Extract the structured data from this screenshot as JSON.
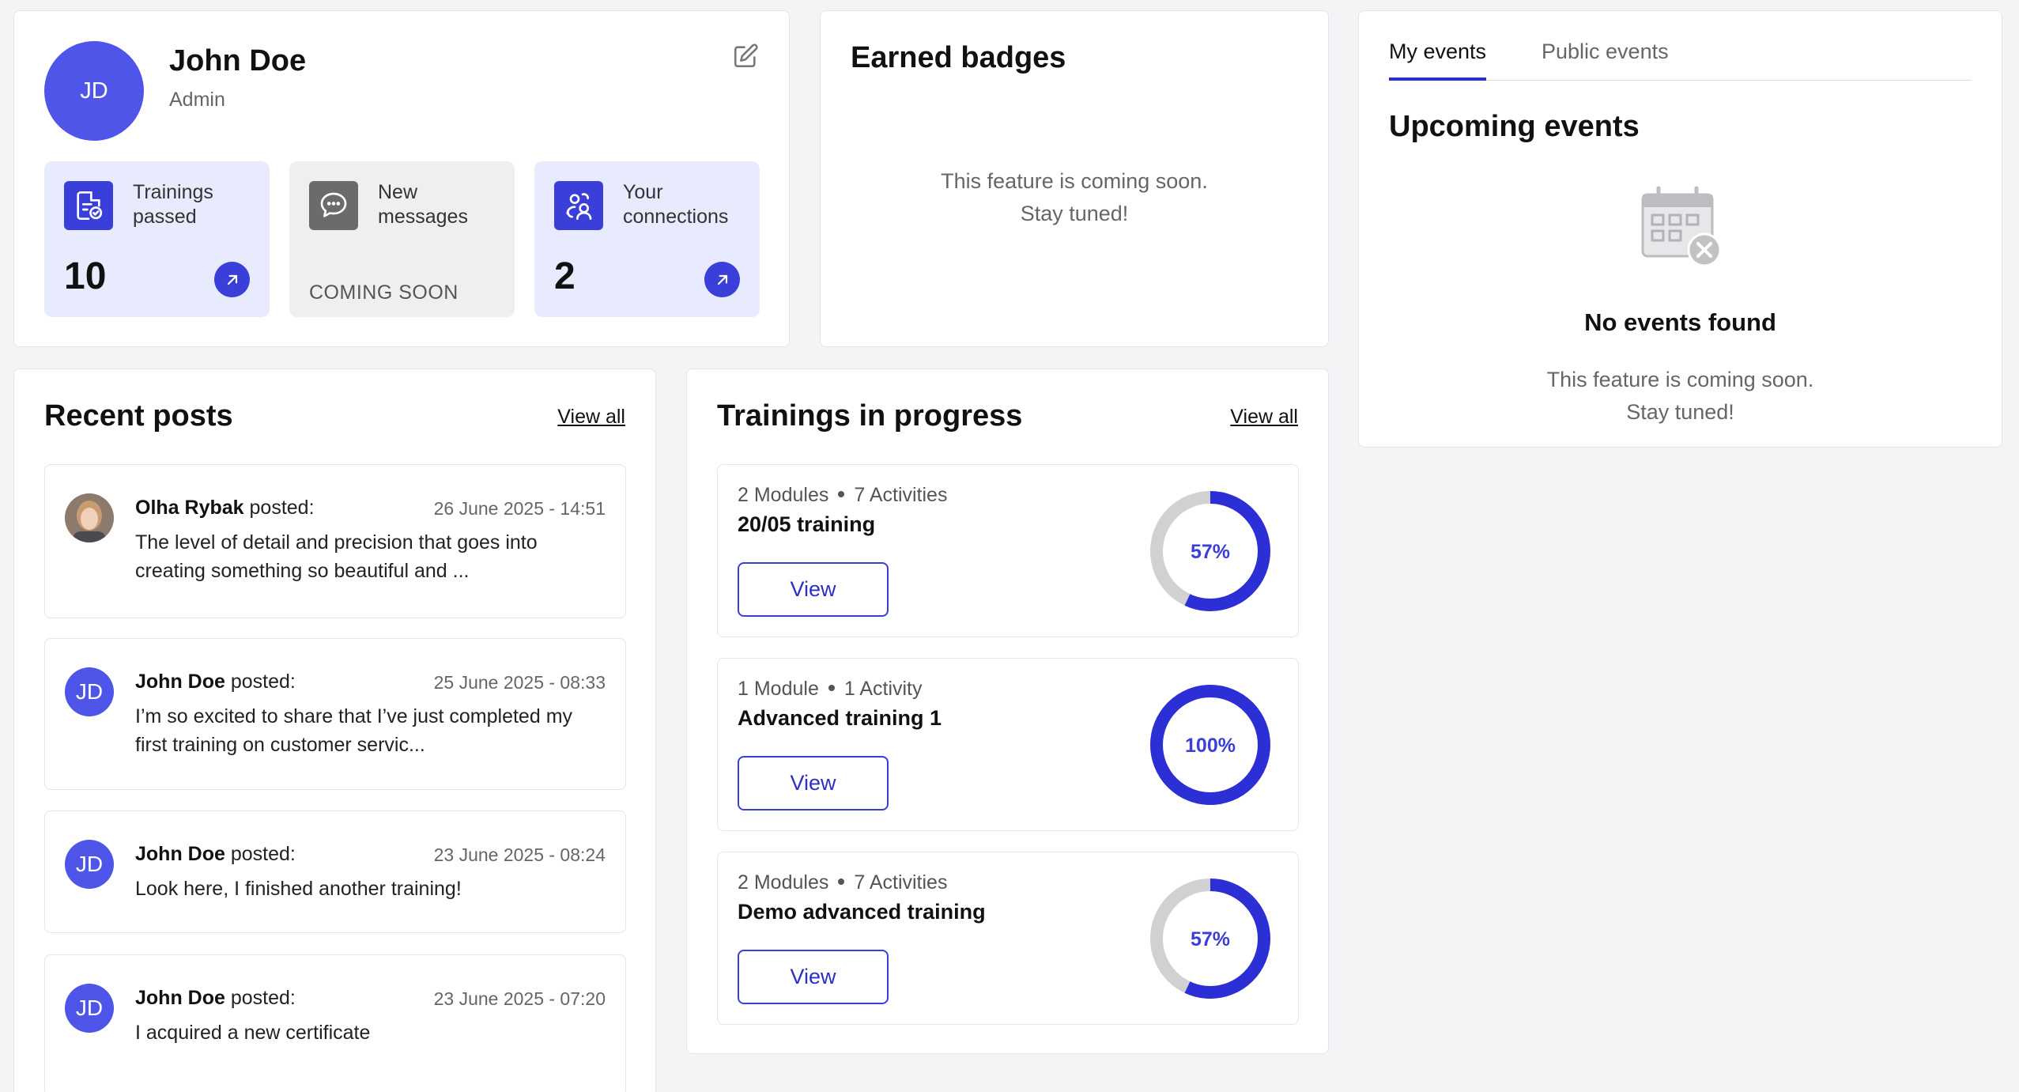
{
  "profile": {
    "initials": "JD",
    "name": "John Doe",
    "role": "Admin",
    "stats": [
      {
        "label": "Trainings passed",
        "value": "10",
        "status": "active"
      },
      {
        "label": "New messages",
        "value": "COMING SOON",
        "status": "soon"
      },
      {
        "label": "Your connections",
        "value": "2",
        "status": "active"
      }
    ]
  },
  "badges": {
    "title": "Earned badges",
    "soon_line1": "This feature is coming soon.",
    "soon_line2": "Stay tuned!"
  },
  "events": {
    "tabs": [
      "My events",
      "Public events"
    ],
    "active_tab": "My events",
    "title": "Upcoming events",
    "empty_title": "No events found",
    "soon_line1": "This feature is coming soon.",
    "soon_line2": "Stay tuned!"
  },
  "posts": {
    "title": "Recent posts",
    "view_all": "View all",
    "items": [
      {
        "author": "Olha Rybak",
        "verb": "posted:",
        "date": "26 June 2025 - 14:51",
        "body": "The level of detail and precision that goes into creating something so beautiful and ...",
        "avatar": "photo"
      },
      {
        "author": "John Doe",
        "verb": "posted:",
        "date": "25 June 2025 - 08:33",
        "body": "I’m so excited to share that I’ve just completed my first training on customer servic...",
        "avatar": "JD"
      },
      {
        "author": "John Doe",
        "verb": "posted:",
        "date": "23 June 2025 - 08:24",
        "body": "Look here, I finished another training!",
        "avatar": "JD"
      },
      {
        "author": "John Doe",
        "verb": "posted:",
        "date": "23 June 2025 - 07:20",
        "body": "I acquired a new certificate",
        "avatar": "JD"
      }
    ]
  },
  "trainings": {
    "title": "Trainings in progress",
    "view_all": "View all",
    "items": [
      {
        "modules": "2 Modules",
        "activities": "7 Activities",
        "name": "20/05 training",
        "button": "View",
        "progress": 57,
        "progress_label": "57%"
      },
      {
        "modules": "1 Module",
        "activities": "1 Activity",
        "name": "Advanced training 1",
        "button": "View",
        "progress": 100,
        "progress_label": "100%"
      },
      {
        "modules": "2 Modules",
        "activities": "7 Activities",
        "name": "Demo advanced training",
        "button": "View",
        "progress": 57,
        "progress_label": "57%"
      }
    ]
  },
  "colors": {
    "accent": "#3b3fd9",
    "avatar": "#4f55e8",
    "ring_track": "#d1d1d4",
    "ring_fill": "#2c2fd6",
    "stat_active_bg": "#e7ebfd",
    "stat_soon_bg": "#efeff0"
  }
}
